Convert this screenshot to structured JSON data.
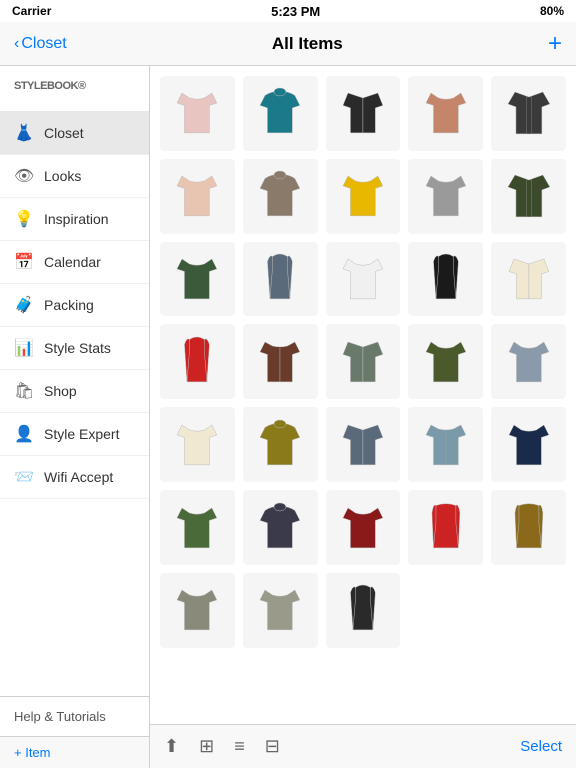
{
  "status_bar": {
    "carrier": "Carrier",
    "time": "5:23 PM",
    "battery": "80%"
  },
  "nav": {
    "back_label": "Closet",
    "title": "All Items",
    "add_label": "+"
  },
  "sidebar": {
    "logo": "STYLEBOOK",
    "logo_trademark": "®",
    "items": [
      {
        "id": "closet",
        "label": "Closet",
        "icon": "👗",
        "active": true
      },
      {
        "id": "looks",
        "label": "Looks",
        "icon": "👁"
      },
      {
        "id": "inspiration",
        "label": "Inspiration",
        "icon": "💡"
      },
      {
        "id": "calendar",
        "label": "Calendar",
        "icon": "📅"
      },
      {
        "id": "packing",
        "label": "Packing",
        "icon": "🧳"
      },
      {
        "id": "style-stats",
        "label": "Style Stats",
        "icon": "📊"
      },
      {
        "id": "shop",
        "label": "Shop",
        "icon": "🛍"
      },
      {
        "id": "style-expert",
        "label": "Style Expert",
        "icon": "👤"
      },
      {
        "id": "wifi-accept",
        "label": "Wifi Accept",
        "icon": "📨"
      }
    ],
    "footer": "Help & Tutorials",
    "add_item_label": "+ Item"
  },
  "content": {
    "select_label": "Select",
    "items": [
      {
        "id": 1,
        "color": "#e8c5c0",
        "type": "tshirt",
        "shape": "loose-top"
      },
      {
        "id": 2,
        "color": "#1a7a8a",
        "type": "sweater",
        "shape": "cowl-neck"
      },
      {
        "id": 3,
        "color": "#2a2a2a",
        "type": "cardigan",
        "shape": "embellished"
      },
      {
        "id": 4,
        "color": "#c4856a",
        "type": "top",
        "shape": "tie-front"
      },
      {
        "id": 5,
        "color": "#3a3a3a",
        "type": "jacket",
        "shape": "slim"
      },
      {
        "id": 6,
        "color": "#e8c5b0",
        "type": "top",
        "shape": "light"
      },
      {
        "id": 7,
        "color": "#8a7a6a",
        "type": "sweater",
        "shape": "cowl"
      },
      {
        "id": 8,
        "color": "#e8b800",
        "type": "top",
        "shape": "spaghetti"
      },
      {
        "id": 9,
        "color": "#9a9a9a",
        "type": "top",
        "shape": "flowy"
      },
      {
        "id": 10,
        "color": "#3a4a2a",
        "type": "jacket",
        "shape": "utility"
      },
      {
        "id": 11,
        "color": "#3a5a3a",
        "type": "top",
        "shape": "boxy"
      },
      {
        "id": 12,
        "color": "#5a6a7a",
        "type": "tank",
        "shape": "racerback"
      },
      {
        "id": 13,
        "color": "#f0f0f0",
        "type": "top",
        "shape": "peplum"
      },
      {
        "id": 14,
        "color": "#1a1a1a",
        "type": "tank",
        "shape": "spaghetti"
      },
      {
        "id": 15,
        "color": "#f0e8d0",
        "type": "cardigan",
        "shape": "open"
      },
      {
        "id": 16,
        "color": "#cc2222",
        "type": "tank",
        "shape": "racerback"
      },
      {
        "id": 17,
        "color": "#6a3a2a",
        "type": "shirt",
        "shape": "plaid"
      },
      {
        "id": 18,
        "color": "#6a7a6a",
        "type": "cardigan",
        "shape": "longline"
      },
      {
        "id": 19,
        "color": "#4a5a2a",
        "type": "top",
        "shape": "military"
      },
      {
        "id": 20,
        "color": "#8a9aaa",
        "type": "tshirt",
        "shape": "basic"
      },
      {
        "id": 21,
        "color": "#f0e8d0",
        "type": "top",
        "shape": "peasant"
      },
      {
        "id": 22,
        "color": "#8a7a1a",
        "type": "sweater",
        "shape": "knit"
      },
      {
        "id": 23,
        "color": "#5a6a7a",
        "type": "cardigan",
        "shape": "drape"
      },
      {
        "id": 24,
        "color": "#7a9aaa",
        "type": "shirt",
        "shape": "floral"
      },
      {
        "id": 25,
        "color": "#1a2a4a",
        "type": "tshirt",
        "shape": "vneck"
      },
      {
        "id": 26,
        "color": "#4a6a3a",
        "type": "top",
        "shape": "peasant2"
      },
      {
        "id": 27,
        "color": "#3a3a4a",
        "type": "sweater",
        "shape": "fitted"
      },
      {
        "id": 28,
        "color": "#8a1a1a",
        "type": "top",
        "shape": "satin"
      },
      {
        "id": 29,
        "color": "#cc2222",
        "type": "vest",
        "shape": "open"
      },
      {
        "id": 30,
        "color": "#8a6a1a",
        "type": "vest",
        "shape": "utility"
      },
      {
        "id": 31,
        "color": "#8a8a7a",
        "type": "top",
        "shape": "henley"
      },
      {
        "id": 32,
        "color": "#9a9a8a",
        "type": "tshirt",
        "shape": "striped"
      },
      {
        "id": 33,
        "color": "#2a2a2a",
        "type": "tank",
        "shape": "floral2"
      }
    ]
  }
}
